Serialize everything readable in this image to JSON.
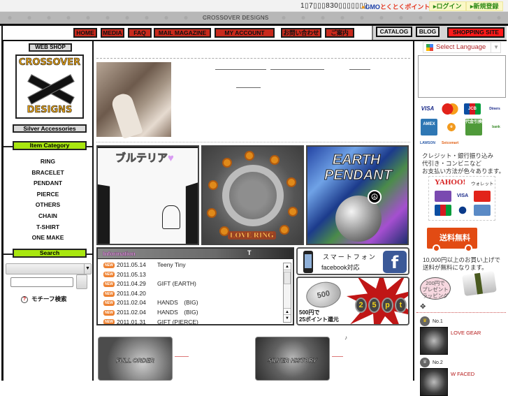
{
  "topbar": {
    "counter": "1▯7▯▯▯830▯▯▯▯▯▯▯",
    "gmo_brand": "GMO",
    "gmo_points": "とくとくポイント",
    "login": "▸ログイン",
    "register": "▸新規登録"
  },
  "brand_strip": "CROSSOVER DESIGNS",
  "nav": {
    "items": [
      "HOME",
      "MEDIA",
      "FAQ",
      "MAIL MAGAZINE",
      "MY ACCOUNT",
      "お問い合わせ",
      "ご案内"
    ],
    "catalog": "CATALOG",
    "blog": "BLOG",
    "shopping_site": "SHOPPING SITE"
  },
  "sidebar": {
    "web_shop": "WEB SHOP",
    "logo_top": "CROSSOVER",
    "logo_bottom": "DESIGNS",
    "silver": "Silver Accessories",
    "item_category": "Item Category",
    "categories": [
      "RING",
      "BRACELET",
      "PENDANT",
      "PIERCE",
      "OTHERS",
      "CHAIN",
      "T-SHIRT",
      "ONE MAKE"
    ],
    "search_label": "Search",
    "search_select": "",
    "search_input": "",
    "motif_search": "モチーフ検索"
  },
  "main": {
    "banners": {
      "tshirt_text": "ブルテリア",
      "heart": "♥",
      "love_ring": "LOVE RING",
      "earth_line1": "EARTH",
      "earth_line2": "PENDANT",
      "peace": "☮"
    },
    "info": {
      "title": "Information",
      "t_label": "T",
      "new_badge": "NEW",
      "rows": [
        {
          "date": "2011.05.14",
          "text": "Teeny Tiny"
        },
        {
          "date": "2011.05.13",
          "text": ""
        },
        {
          "date": "2011.04.29",
          "text": "GIFT (EARTH)"
        },
        {
          "date": "2011.04.20",
          "text": ""
        },
        {
          "date": "2011.02.04",
          "text": "HANDS　(BIG)"
        },
        {
          "date": "2011.02.04",
          "text": "HANDS　(BIG)"
        },
        {
          "date": "2011.01.31",
          "text": "GIFT (PIERCE)"
        }
      ]
    },
    "smartphone": {
      "line1": "スマートフォン",
      "line2": "facebook対応",
      "fb": "f"
    },
    "coin": {
      "coin_value": "500",
      "points": [
        "2",
        "5",
        "p",
        "t"
      ],
      "caption_line1": "500円で",
      "caption_line2": "25ポイント還元"
    },
    "promos": {
      "full_order": "FULL ORDER",
      "silver_history": "SILVER HISTORY",
      "note": "♪"
    }
  },
  "right": {
    "select_language": "Select Language",
    "cards": [
      "VISA",
      "MC",
      "JCB",
      "Diners",
      "AMEX",
      "e",
      "代金引換",
      "bank",
      "LAWSON",
      "Seicomart"
    ],
    "pay_text": [
      "クレジット・銀行振り込み",
      "代引き・コンビニなど",
      "お支払い方法が色々あります。"
    ],
    "yahoo_logo": "YAHOO!",
    "yahoo_wallet": "ウォレット",
    "free_shipping": "送料無料",
    "ship_text": [
      "10,000円以上のお買い上げで",
      "送料が無料になります。"
    ],
    "wrapping": [
      "200円で",
      "プレゼント",
      "ラッピング"
    ],
    "ranking": [
      {
        "no": "No.1",
        "name": "LOVE GEAR"
      },
      {
        "no": "No.2",
        "name": "W FACED"
      }
    ]
  }
}
